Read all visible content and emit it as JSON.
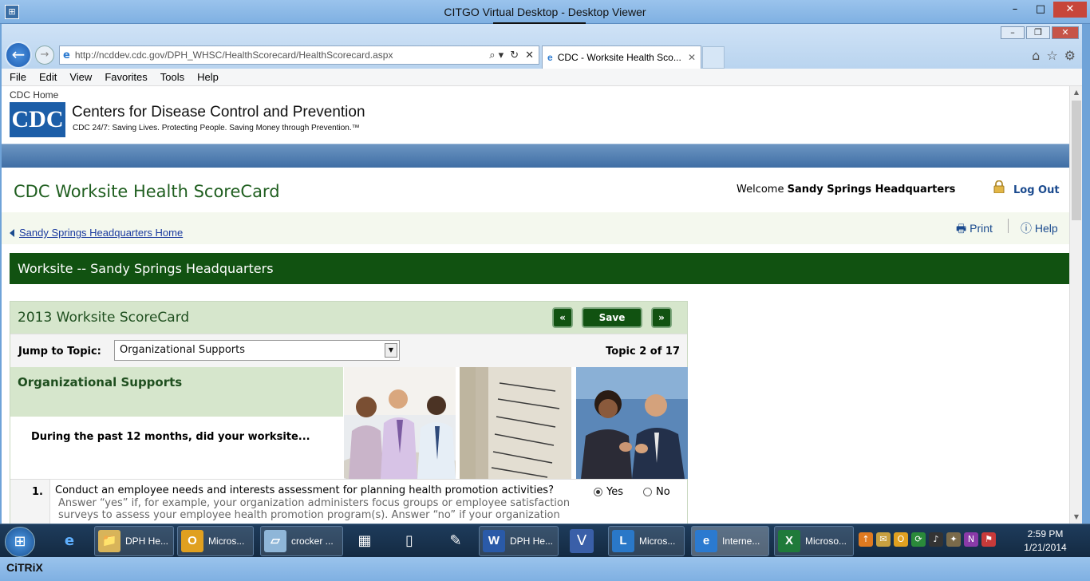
{
  "viewer": {
    "app_icon": "⊞",
    "title": "CITGO Virtual Desktop - Desktop Viewer",
    "min": "–",
    "max": "□",
    "close": "✕",
    "drag": "⠿⠿⠿⠿ ⬇ ⠿⠿⠿⠿"
  },
  "browser": {
    "back": "←",
    "forward": "→",
    "address": "http://ncddev.cdc.gov/DPH_WHSC/HealthScorecard/HealthScorecard.aspx",
    "address_tools": [
      "⌕ ▾",
      "↻",
      "✕"
    ],
    "tab_title": "CDC - Worksite Health Sco...",
    "tab_close": "✕",
    "right_icons": [
      "⌂",
      "☆",
      "⚙"
    ],
    "ie_min": "–",
    "ie_max": "❐",
    "ie_close": "✕",
    "menu": [
      "File",
      "Edit",
      "View",
      "Favorites",
      "Tools",
      "Help"
    ]
  },
  "cdc": {
    "home": "CDC Home",
    "logo": "CDC",
    "name": "Centers for Disease Control and Prevention",
    "tagline": "CDC 24/7: Saving Lives. Protecting People. Saving Money through Prevention.™"
  },
  "app": {
    "title": "CDC Worksite Health ScoreCard",
    "welcome_prefix": "Welcome ",
    "welcome_name": "Sandy Springs Headquarters",
    "logout": "Log Out",
    "breadcrumb": "Sandy Springs Headquarters Home",
    "print": "Print",
    "help": "Help",
    "worksite_banner": "Worksite -- Sandy Springs Headquarters"
  },
  "scorecard": {
    "title": "2013 Worksite ScoreCard",
    "prev": "«",
    "save": "Save",
    "next": "»",
    "jump_label": "Jump to Topic:",
    "selected_topic": "Organizational Supports",
    "topic_count": "Topic 2 of 17",
    "section_title": "Organizational Supports",
    "prompt": "During the past 12 months, did your worksite...",
    "questions": [
      {
        "num": "1.",
        "text": "Conduct an employee needs and interests assessment for planning health promotion activities?",
        "help": "Answer “yes” if, for example, your organization administers focus groups or employee satisfaction surveys to assess your employee health promotion program(s). Answer “no” if your organization",
        "yes": "Yes",
        "no": "No",
        "answer": "Yes"
      }
    ]
  },
  "taskbar": {
    "buttons": [
      {
        "label": "DPH He...",
        "icon": "📁"
      },
      {
        "label": "Micros...",
        "icon": "O"
      },
      {
        "label": "crocker ...",
        "icon": "▱"
      },
      {
        "label": "DPH He...",
        "icon": "W"
      },
      {
        "label": "Micros...",
        "icon": "L"
      },
      {
        "label": "Interne...",
        "icon": "e"
      },
      {
        "label": "Microso...",
        "icon": "X"
      }
    ],
    "time": "2:59 PM",
    "date": "1/21/2014"
  },
  "citrix": "CiTRiX"
}
